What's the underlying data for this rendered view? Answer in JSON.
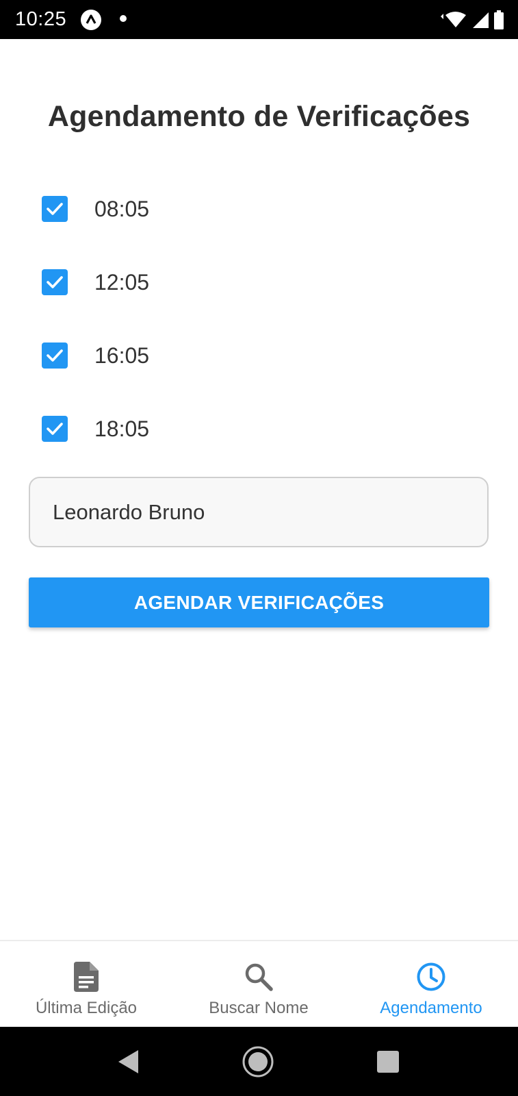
{
  "status_bar": {
    "time": "10:25",
    "icons": [
      "app-notification-icon",
      "dot-icon",
      "wifi-icon",
      "signal-icon",
      "battery-icon"
    ]
  },
  "page": {
    "title": "Agendamento de Verificações"
  },
  "schedule_times": [
    {
      "label": "08:05",
      "checked": true
    },
    {
      "label": "12:05",
      "checked": true
    },
    {
      "label": "16:05",
      "checked": true
    },
    {
      "label": "18:05",
      "checked": true
    }
  ],
  "name_input": {
    "value": "Leonardo Bruno"
  },
  "schedule_button": {
    "label": "AGENDAR VERIFICAÇÕES"
  },
  "tabs": [
    {
      "label": "Última Edição",
      "icon": "document-icon",
      "active": false
    },
    {
      "label": "Buscar Nome",
      "icon": "search-icon",
      "active": false
    },
    {
      "label": "Agendamento",
      "icon": "clock-icon",
      "active": true
    }
  ],
  "nav_bar": {
    "icons": [
      "back-icon",
      "home-icon",
      "recents-icon"
    ]
  },
  "colors": {
    "accent": "#2196f3",
    "title": "#2f2f2f",
    "inactive_tab": "#6b6b6b",
    "system_bar": "#000000"
  }
}
